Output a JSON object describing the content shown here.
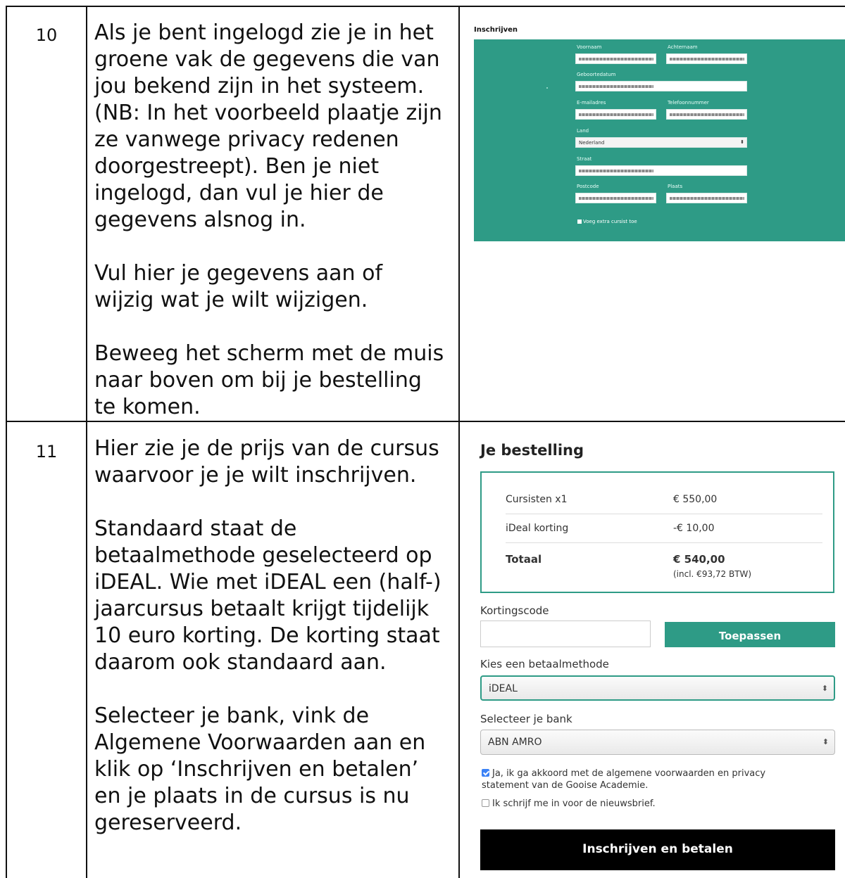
{
  "rows": [
    {
      "number": "10",
      "paragraphs": [
        "Als je bent ingelogd zie je in het groene vak de gegevens die van jou bekend zijn in het systeem. (NB: In het voorbeeld plaatje zijn ze vanwege privacy redenen doorgestreept). Ben je niet ingelogd, dan vul je hier de gegevens alsnog in.",
        "Vul hier je gegevens aan of wijzig wat je wilt wijzigen.",
        "Beweeg het scherm met de muis naar boven om bij je bestelling te komen."
      ]
    },
    {
      "number": "11",
      "paragraphs": [
        "Hier zie je de prijs van de cursus waarvoor je je wilt inschrijven.",
        "Standaard staat de betaalmethode geselecteerd op iDEAL. Wie met iDEAL een (half-) jaarcursus betaalt krijgt tijdelijk 10 euro korting. De korting staat daarom ook standaard aan.",
        "Selecteer je bank, vink de Algemene Voorwaarden aan en klik op ‘Inschrijven en betalen’ en je plaats in de cursus is nu gereserveerd."
      ]
    }
  ],
  "form": {
    "title": "Inschrijven",
    "voornaam": "Voornaam",
    "achternaam": "Achternaam",
    "geboortedatum": "Geboortedatum",
    "email": "E-mailadres",
    "telefoon": "Telefoonnummer",
    "land": "Land",
    "land_value": "Nederland",
    "straat": "Straat",
    "postcode": "Postcode",
    "plaats": "Plaats",
    "extra": "Voeg extra cursist toe",
    "color": "#2e9b86"
  },
  "order": {
    "title": "Je bestelling",
    "lines": [
      {
        "label": "Cursisten x1",
        "value": "€ 550,00"
      },
      {
        "label": "iDeal korting",
        "value": "-€ 10,00"
      }
    ],
    "total_label": "Totaal",
    "total_value": "€ 540,00",
    "total_tax": "(incl. €93,72 BTW)",
    "coupon_label": "Kortingscode",
    "coupon_value": "",
    "apply_label": "Toepassen",
    "method_label": "Kies een betaalmethode",
    "method_value": "iDEAL",
    "bank_label": "Selecteer je bank",
    "bank_value": "ABN AMRO",
    "terms_label": "Ja, ik ga akkoord met de algemene voorwaarden en privacy statement van de Gooise Academie.",
    "terms_checked": true,
    "newsletter_label": "Ik schrijf me in voor de nieuwsbrief.",
    "newsletter_checked": false,
    "submit_label": "Inschrijven en betalen"
  }
}
